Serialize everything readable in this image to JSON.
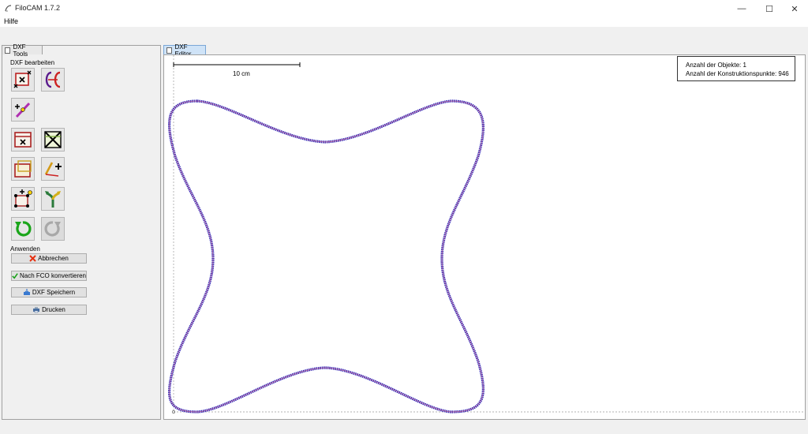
{
  "window": {
    "title": "FiloCAM 1.7.2",
    "minimize": "—",
    "maximize": "☐",
    "close": "✕"
  },
  "menu": {
    "items": [
      "Hilfe"
    ]
  },
  "tabs": {
    "left": "DXF Tools",
    "right": "DXF Editor"
  },
  "tools": {
    "group_edit_label": "DXF bearbeiten",
    "group_apply_label": "Anwenden",
    "buttons": [
      {
        "name": "delete-points-tool",
        "icon": "delete-points-icon"
      },
      {
        "name": "split-contour-tool",
        "icon": "split-contour-icon"
      },
      {
        "name": "add-points-tool",
        "icon": "add-points-icon"
      },
      {
        "name": "delete-object-tool",
        "icon": "delete-object-icon"
      },
      {
        "name": "delete-all-tool",
        "icon": "delete-all-icon"
      },
      {
        "name": "offset-contour-tool",
        "icon": "offset-contour-icon"
      },
      {
        "name": "add-line-tool",
        "icon": "add-line-icon"
      },
      {
        "name": "move-points-tool",
        "icon": "move-points-icon"
      },
      {
        "name": "merge-tool",
        "icon": "merge-icon"
      },
      {
        "name": "undo-tool",
        "icon": "undo-icon"
      },
      {
        "name": "redo-tool",
        "icon": "redo-icon"
      }
    ],
    "actions": [
      {
        "label": "Abbrechen",
        "icon": "cancel-icon"
      },
      {
        "label": "Nach FCO konvertieren",
        "icon": "check-icon"
      },
      {
        "label": "DXF Speichern",
        "icon": "save-icon"
      },
      {
        "label": "Drucken",
        "icon": "print-icon"
      }
    ]
  },
  "editor": {
    "scale_label": "10 cm",
    "info_objects": "Anzahl der Objekte: 1",
    "info_points": "Anzahl der Konstruktionspunkte: 946"
  },
  "colors": {
    "contour": "#2a1fb5",
    "accent_tab": "#cfe3f7"
  }
}
